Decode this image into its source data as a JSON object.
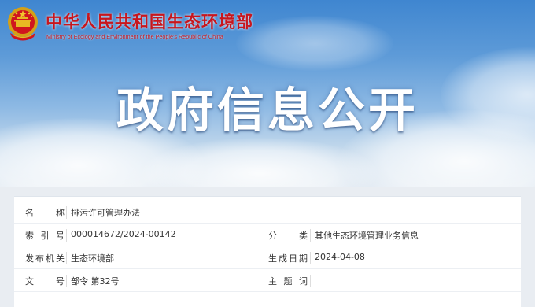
{
  "header": {
    "ministry_name_cn": "中华人民共和国生态环境部",
    "ministry_name_en": "Ministry of Ecology and Environment of the People's Republic of China",
    "banner_title": "政府信息公开"
  },
  "colors": {
    "brand_red": "#c8161d",
    "sky_blue": "#3f86d0",
    "text": "#333333"
  },
  "info": {
    "name_label": "名　称",
    "name_value": "排污许可管理办法",
    "index_label": "索引号",
    "index_value": "000014672/2024-00142",
    "category_label": "分　类",
    "category_value": "其他生态环境管理业务信息",
    "issuer_label": "发布机关",
    "issuer_value": "生态环境部",
    "date_label": "生成日期",
    "date_value": "2024-04-08",
    "docno_label": "文　号",
    "docno_value": "部令 第32号",
    "keywords_label": "主题词",
    "keywords_value": ""
  }
}
